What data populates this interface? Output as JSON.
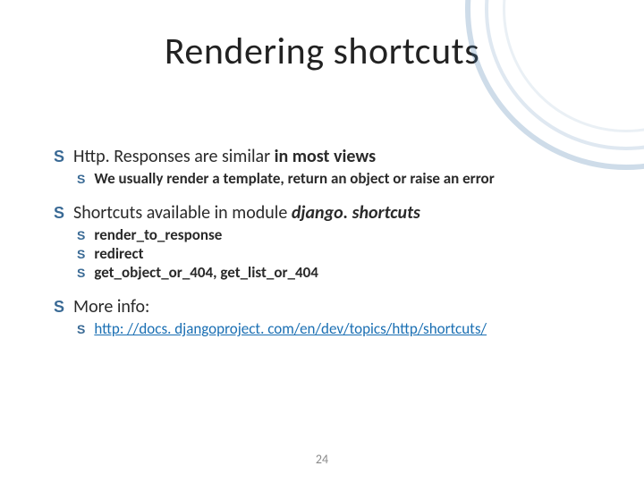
{
  "title": "Rendering shortcuts",
  "bulletGlyph": "S",
  "items": [
    {
      "text_pre": "Http. Responses are similar ",
      "text_bold": "in most views",
      "text_post": "",
      "sub": [
        {
          "text": "We usually render a template, return an object or raise an error"
        }
      ]
    },
    {
      "text_pre": "Shortcuts available in module ",
      "text_bold_italic": "django. shortcuts",
      "sub": [
        {
          "text": "render_to_response"
        },
        {
          "text": "redirect"
        },
        {
          "text": "get_object_or_404, get_list_or_404"
        }
      ]
    },
    {
      "text_pre": "More info:",
      "sub": [
        {
          "link": "http: //docs. djangoproject. com/en/dev/topics/http/shortcuts/"
        }
      ]
    }
  ],
  "pageNumber": "24"
}
